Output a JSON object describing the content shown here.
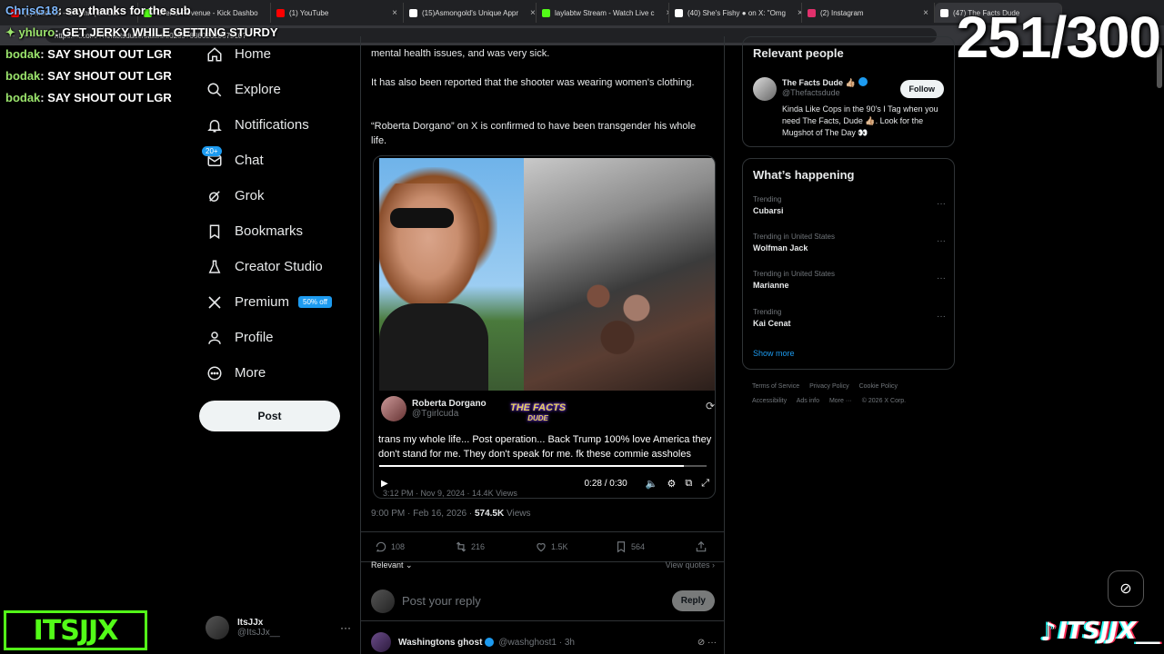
{
  "browser": {
    "tabs": [
      {
        "label": "(1) Mdot 59 - Oh Shit (Official",
        "color": "#ff0000"
      },
      {
        "label": "Overall Revenue - Kick Dashbo",
        "color": "#53fc18"
      },
      {
        "label": "(1) YouTube",
        "color": "#ff0000"
      },
      {
        "label": "(15)Asmongold's Unique Appr",
        "color": "#ffffff"
      },
      {
        "label": "laylabtw Stream - Watch Live c",
        "color": "#53fc18"
      },
      {
        "label": "(40) She's Fishy ● on X: \"Omg",
        "color": "#ffffff"
      },
      {
        "label": "(2) Instagram",
        "color": "#e1306c"
      },
      {
        "label": "(47) The Facts Dude",
        "color": "#ffffff"
      }
    ],
    "url": "https://x.com/Thefactsdude/status/2023578360262037510?"
  },
  "overlay": {
    "chat": [
      {
        "user": "ChrisG18",
        "message": "say thanks for the sub",
        "user_color": "blue"
      },
      {
        "user": "✦ yhluro",
        "message": "GET JERKY WHILE GETTING STURDY",
        "user_color": "green"
      },
      {
        "user": "bodak",
        "message": "SAY SHOUT OUT LGR",
        "user_color": "green"
      },
      {
        "user": "bodak",
        "message": "SAY SHOUT OUT LGR",
        "user_color": "green"
      },
      {
        "user": "bodak",
        "message": "SAY SHOUT OUT LGR",
        "user_color": "green"
      }
    ],
    "counter": "251/300",
    "logo_left": "ITSJJX",
    "logo_right": "ITSJJX__"
  },
  "nav": {
    "items": [
      {
        "label": "Home",
        "icon": "home-icon"
      },
      {
        "label": "Explore",
        "icon": "search-icon"
      },
      {
        "label": "Notifications",
        "icon": "bell-icon"
      },
      {
        "label": "Chat",
        "icon": "mail-icon",
        "badge": "20+"
      },
      {
        "label": "Grok",
        "icon": "grok-icon"
      },
      {
        "label": "Bookmarks",
        "icon": "bookmark-icon"
      },
      {
        "label": "Creator Studio",
        "icon": "flask-icon"
      },
      {
        "label": "Premium",
        "icon": "x-logo-icon",
        "offer": "50% off"
      },
      {
        "label": "Profile",
        "icon": "person-icon"
      },
      {
        "label": "More",
        "icon": "more-circle-icon"
      }
    ],
    "post_label": "Post",
    "account": {
      "name": "ItsJJx",
      "handle": "@ItsJJx__"
    }
  },
  "post": {
    "text1": "mental health issues, and was very sick.",
    "text2": "It has also been reported that the shooter was wearing women's clothing.",
    "text3": "“Roberta Dorgano” on X is confirmed to have been transgender his whole life.",
    "quote": {
      "name": "Roberta Dorgano",
      "handle": "@Tgirlcuda",
      "watermark": "THE FACTS",
      "watermark_sub": "DUDE",
      "caption": "trans my whole life... Post operation... Back Trump 100% love America they don't stand for me. They don't speak for me. fk these commie assholes",
      "time": "0:28 / 0:30",
      "progress": 0.93,
      "meta": "3:12 PM · Nov 9, 2024 · 14.4K Views"
    },
    "timestamp": "9:00 PM · Feb 16, 2026 · ",
    "views": "574.5K",
    "views_label": " Views",
    "replies": "108",
    "reposts": "216",
    "likes": "1.5K",
    "bookmarks": "564",
    "sort_label": "Relevant",
    "view_quotes": "View quotes"
  },
  "reply": {
    "placeholder": "Post your reply",
    "button": "Reply"
  },
  "next_reply": {
    "name": "Washingtons ghost",
    "handle": "@washghost1 · 3h"
  },
  "sidebar": {
    "relevant_title": "Relevant people",
    "person": {
      "name": "The Facts Dude 👍🏼",
      "handle": "@Thefactsdude",
      "bio": "Kinda Like Cops in the 90's I Tag when you need The Facts, Dude 👍🏼. Look for the Mugshot of The Day 👀",
      "follow": "Follow"
    },
    "happening_title": "What’s happening",
    "trends": [
      {
        "meta": "Trending",
        "name": "Cubarsi"
      },
      {
        "meta": "Trending in United States",
        "name": "Wolfman Jack"
      },
      {
        "meta": "Trending in United States",
        "name": "Marianne"
      },
      {
        "meta": "Trending",
        "name": "Kai Cenat"
      }
    ],
    "show_more": "Show more",
    "footer": [
      "Terms of Service",
      "Privacy Policy",
      "Cookie Policy",
      "Accessibility",
      "Ads info",
      "More ···",
      "© 2026 X Corp."
    ]
  }
}
